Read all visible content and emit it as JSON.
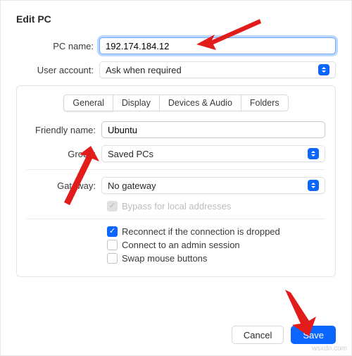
{
  "title": "Edit PC",
  "top": {
    "pc_name_label": "PC name:",
    "pc_name_value": "192.174.184.12",
    "user_account_label": "User account:",
    "user_account_value": "Ask when required"
  },
  "tabs": {
    "general": "General",
    "display": "Display",
    "devices": "Devices & Audio",
    "folders": "Folders"
  },
  "panel": {
    "friendly_label": "Friendly name:",
    "friendly_value": "Ubuntu",
    "group_label": "Group:",
    "group_value": "Saved PCs",
    "gateway_label": "Gateway:",
    "gateway_value": "No gateway",
    "bypass_label": "Bypass for local addresses",
    "reconnect_label": "Reconnect if the connection is dropped",
    "admin_label": "Connect to an admin session",
    "swap_label": "Swap mouse buttons"
  },
  "footer": {
    "cancel": "Cancel",
    "save": "Save"
  },
  "watermark": "wsxdn.com"
}
